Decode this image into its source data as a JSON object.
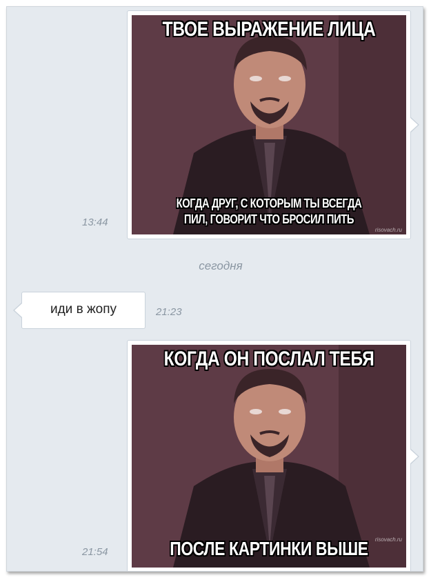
{
  "messages": [
    {
      "direction": "outgoing",
      "type": "image",
      "time": "13:44",
      "meme": {
        "top_text": "ТВОЕ ВЫРАЖЕНИЕ ЛИЦА",
        "bottom_line1": "КОГДА ДРУГ, С КОТОРЫМ ТЫ ВСЕГДА",
        "bottom_line2": "ПИЛ, ГОВОРИТ ЧТО БРОСИЛ ПИТЬ",
        "watermark": "risovach.ru"
      }
    },
    {
      "direction": "incoming",
      "type": "text",
      "text": "иди в жопу",
      "time": "21:23"
    },
    {
      "direction": "outgoing",
      "type": "image",
      "time": "21:54",
      "meme": {
        "top_text": "КОГДА ОН ПОСЛАЛ ТЕБЯ",
        "bottom_line1": "ПОСЛЕ КАРТИНКИ ВЫШЕ",
        "watermark": "risovach.ru"
      }
    }
  ],
  "date_separator": "сегодня",
  "colors": {
    "background": "#e5eaef",
    "bubble": "#ffffff",
    "bubble_border": "#c9d2db",
    "timestamp": "#8a96a2"
  }
}
